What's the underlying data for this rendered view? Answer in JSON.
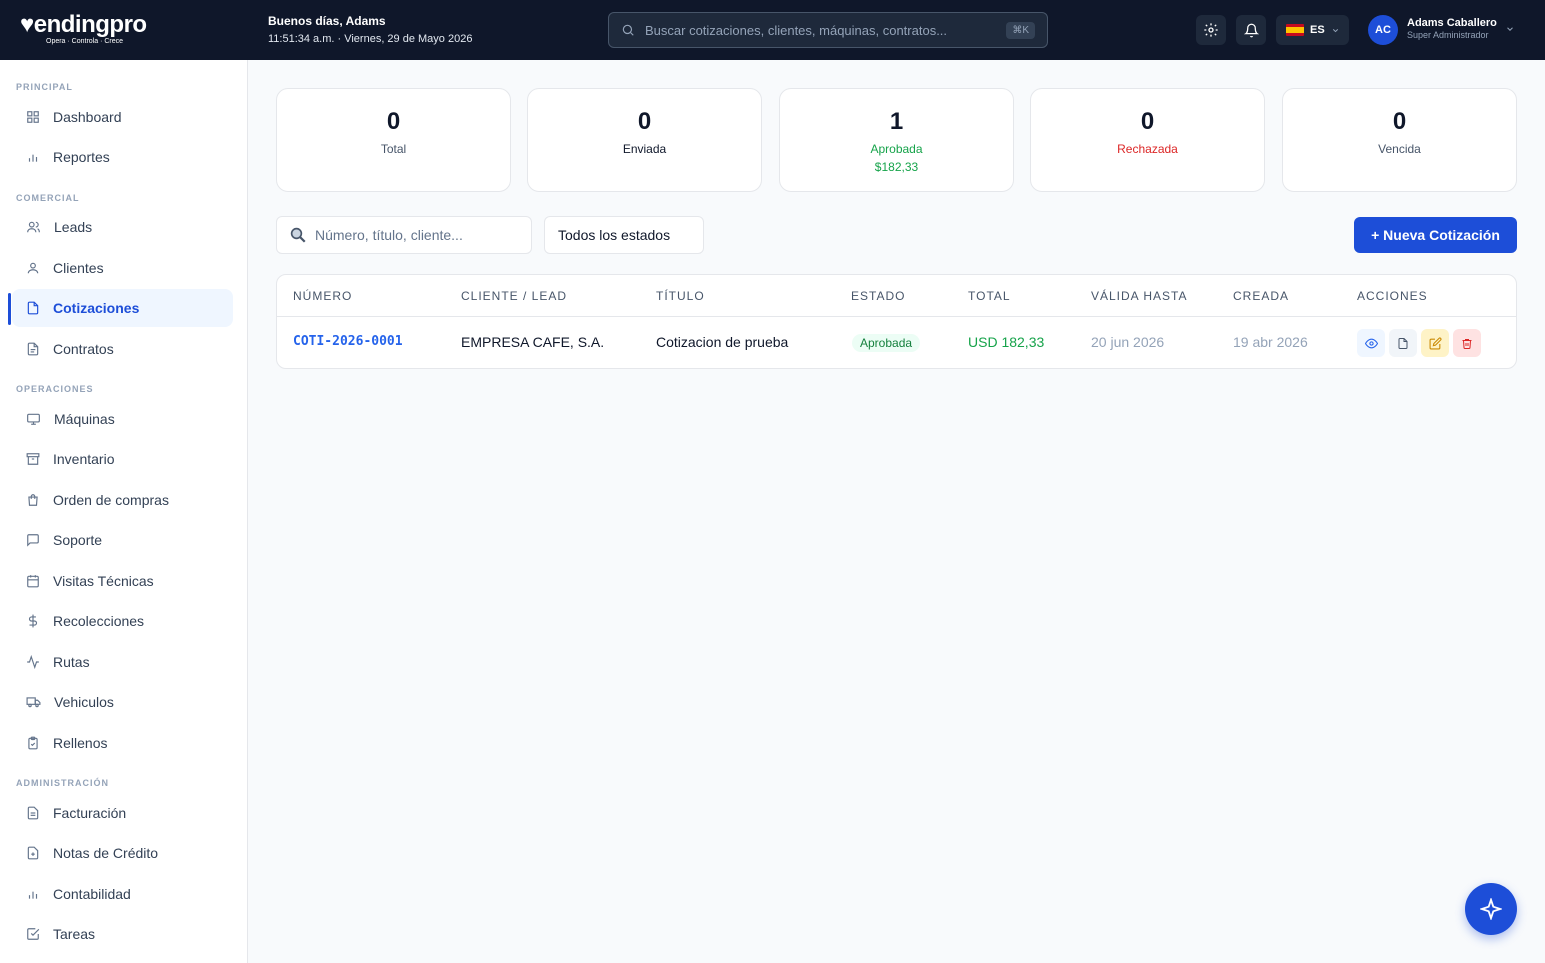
{
  "header": {
    "brand": "endingpro",
    "tagline": "Opera · Controla · Crece",
    "greeting": "Buenos días, Adams",
    "datetime": "11:51:34 a.m. · Viernes, 29 de Mayo 2026",
    "search_placeholder": "Buscar cotizaciones, clientes, máquinas, contratos...",
    "search_shortcut": "⌘K",
    "language": "ES",
    "avatar_initials": "AC",
    "user_name": "Adams Caballero",
    "user_role": "Super Administrador"
  },
  "sidebar": {
    "sections": [
      "PRINCIPAL",
      "COMERCIAL",
      "OPERACIONES",
      "ADMINISTRACIÓN"
    ],
    "items": [
      {
        "label": "Dashboard",
        "icon": "grid-icon"
      },
      {
        "label": "Reportes",
        "icon": "bar-chart-icon"
      },
      {
        "label": "Leads",
        "icon": "users-icon"
      },
      {
        "label": "Clientes",
        "icon": "user-icon"
      },
      {
        "label": "Cotizaciones",
        "icon": "file-icon",
        "active": true
      },
      {
        "label": "Contratos",
        "icon": "file-text-icon"
      },
      {
        "label": "Máquinas",
        "icon": "monitor-icon"
      },
      {
        "label": "Inventario",
        "icon": "archive-icon"
      },
      {
        "label": "Orden de compras",
        "icon": "shopping-bag-icon"
      },
      {
        "label": "Soporte",
        "icon": "message-icon"
      },
      {
        "label": "Visitas Técnicas",
        "icon": "calendar-icon"
      },
      {
        "label": "Recolecciones",
        "icon": "dollar-icon"
      },
      {
        "label": "Rutas",
        "icon": "activity-icon"
      },
      {
        "label": "Vehiculos",
        "icon": "truck-icon"
      },
      {
        "label": "Rellenos",
        "icon": "clipboard-icon"
      },
      {
        "label": "Facturación",
        "icon": "receipt-icon"
      },
      {
        "label": "Notas de Crédito",
        "icon": "file-plus-icon"
      },
      {
        "label": "Contabilidad",
        "icon": "bar-chart-icon"
      },
      {
        "label": "Tareas",
        "icon": "check-square-icon"
      }
    ]
  },
  "stats": [
    {
      "value": "0",
      "label": "Total",
      "color": "#475569"
    },
    {
      "value": "0",
      "label": "Enviada",
      "color": "#0f172a"
    },
    {
      "value": "1",
      "label": "Aprobada",
      "sub": "$182,33",
      "color": "#16a34a"
    },
    {
      "value": "0",
      "label": "Rechazada",
      "color": "#dc2626"
    },
    {
      "value": "0",
      "label": "Vencida",
      "color": "#475569"
    }
  ],
  "filters": {
    "search_placeholder": "Número, título, cliente...",
    "status_select": "Todos los estados",
    "new_button": "+ Nueva Cotización"
  },
  "table": {
    "columns": [
      "NÚMERO",
      "CLIENTE / LEAD",
      "TÍTULO",
      "ESTADO",
      "TOTAL",
      "VÁLIDA HASTA",
      "CREADA",
      "ACCIONES"
    ],
    "rows": [
      {
        "numero": "COTI-2026-0001",
        "cliente": "EMPRESA CAFE, S.A.",
        "titulo": "Cotizacion de prueba",
        "estado": "Aprobada",
        "total": "USD 182,33",
        "valida_hasta": "20 jun 2026",
        "creada": "19 abr 2026"
      }
    ]
  },
  "colors": {
    "topbar": "#0f172a",
    "accent": "#1d4ed8",
    "success": "#16a34a",
    "danger": "#dc2626"
  }
}
